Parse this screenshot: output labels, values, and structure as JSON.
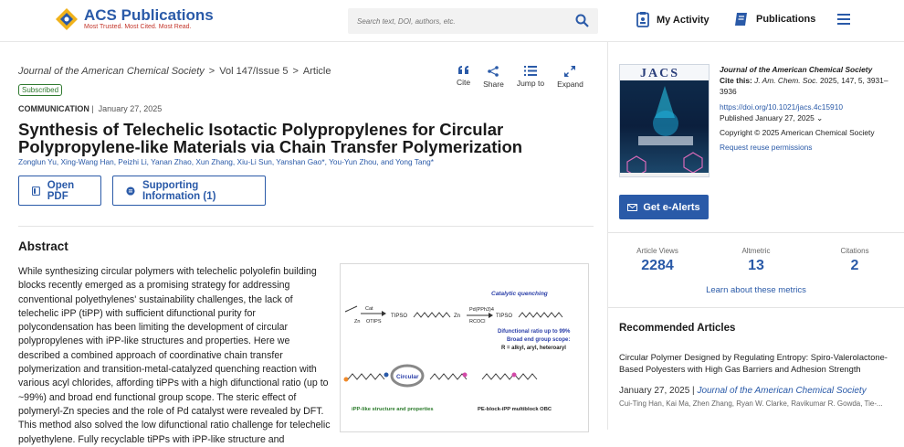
{
  "header": {
    "logo_name": "ACS Publications",
    "logo_tagline": "Most Trusted. Most Cited. Most Read.",
    "search_placeholder": "Search text, DOI, authors, etc.",
    "my_activity": "My Activity",
    "publications": "Publications"
  },
  "breadcrumb": {
    "journal": "Journal of the American Chemical Society",
    "issue": "Vol 147/Issue 5",
    "article": "Article"
  },
  "badge": "Subscribed",
  "tools": {
    "cite": "Cite",
    "share": "Share",
    "jump": "Jump to",
    "expand": "Expand"
  },
  "article": {
    "type": "COMMUNICATION",
    "date": "January 27, 2025",
    "title": "Synthesis of Telechelic Isotactic Polypropylenes for Circular Polypropylene-like Materials via Chain Transfer Polymerization",
    "authors": "Zonglun Yu, Xing-Wang Han, Peizhi Li, Yanan Zhao, Xun Zhang, Xiu-Li Sun, Yanshan Gao*, You-Yun Zhou, and Yong Tang*"
  },
  "buttons": {
    "open_pdf": "Open PDF",
    "supporting": "Supporting Information (1)",
    "alerts": "Get e-Alerts"
  },
  "abstract": {
    "heading": "Abstract",
    "text": "While synthesizing circular polymers with telechelic polyolefin building blocks recently emerged as a promising strategy for addressing conventional polyethylenes' sustainability challenges, the lack of telechelic iPP (tiPP) with sufficient difunctional purity for polycondensation has been limiting the development of circular polypropylenes with iPP-like structures and properties. Here we described a combined approach of coordinative chain transfer polymerization and transition-metal-catalyzed quenching reaction with various acyl chlorides, affording tiPPs with a high difunctional ratio (up to ~99%) and broad end functional group scope. The steric effect of polymeryl-Zn species and the role of Pd catalyst were revealed by DFT. This method also solved the low difunctional ratio challenge for telechelic polyethylene. Fully recyclable tiPPs with iPP-like structure and"
  },
  "toc": {
    "cat": "Cat",
    "catalytic": "Catalytic quenching",
    "pd": "Pd(PPh3)4",
    "rcocl": "RCOCl",
    "tipso1": "TIPSO",
    "tipso2": "TIPSO",
    "otips": "OTIPS",
    "zn": "Zn",
    "zn2": "Zn",
    "ratio": "Difunctional ratio up to 99%",
    "scope1": "Broad end group scope:",
    "scope2": "R = alkyl, aryl, heteroaryl",
    "circular": "Circular",
    "ipp_like": "iPP-like structure and properties",
    "obc": "PE-block-iPP multiblock OBC"
  },
  "sidebar": {
    "cover_title": "JACS",
    "journal": "Journal of the American Chemical Society",
    "cite_label": "Cite this:",
    "cite_journal": "J. Am. Chem. Soc.",
    "cite_ref": "2025, 147, 5, 3931–3936",
    "doi": "https://doi.org/10.1021/jacs.4c15910",
    "published": "Published January 27, 2025",
    "copyright": "Copyright © 2025 American Chemical Society",
    "reuse": "Request reuse permissions"
  },
  "metrics": {
    "views_label": "Article Views",
    "views": "2284",
    "altmetric_label": "Altmetric",
    "altmetric": "13",
    "citations_label": "Citations",
    "citations": "2",
    "learn": "Learn about these metrics"
  },
  "recommended": {
    "heading": "Recommended Articles",
    "title": "Circular Polymer Designed by Regulating Entropy: Spiro-Valerolactone-Based Polyesters with High Gas Barriers and Adhesion Strength",
    "date": "January 27, 2025",
    "journal": "Journal of the American Chemical Society",
    "authors": "Cui-Ting Han, Kai Ma, Zhen Zhang, Ryan W. Clarke, Ravikumar R. Gowda, Tie-..."
  },
  "colors": {
    "accent": "#2a5aa8",
    "logo_red": "#c3362b",
    "logo_gold": "#f0b21b"
  }
}
